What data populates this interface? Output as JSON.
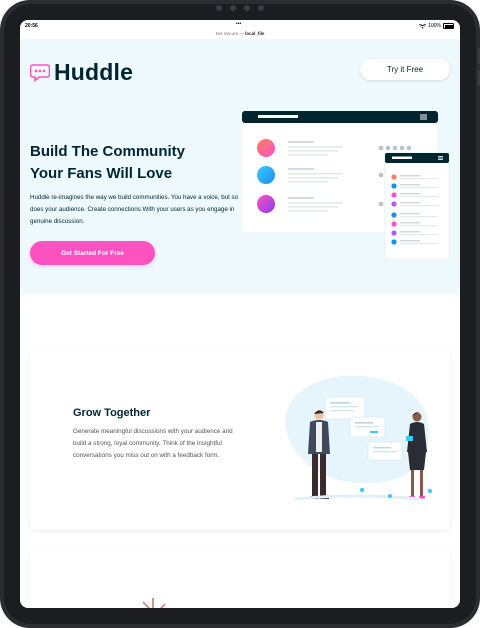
{
  "status_bar": {
    "time": "20:56",
    "dots": "•••",
    "battery": "100%"
  },
  "url_bar": {
    "prefix": "Not Secure — ",
    "host": "local_file"
  },
  "header": {
    "brand": "Huddle",
    "try_button": "Try it Free"
  },
  "hero": {
    "title_line1": "Build The Community",
    "title_line2": "Your Fans Will Love",
    "text": "Huddle re-imagines the way we build communities. You have a voice, but so does your audience. Create connections With your users as you engage in genuine discussion.",
    "cta": "Get Started For Free"
  },
  "feature": {
    "title": "Grow Together",
    "text": "Generate meaningful discussions with your audience and build a strong, loyal community. Think of the insightful conversations you miss out on with a feedback form."
  },
  "colors": {
    "brand_dark": "#00252e",
    "accent_pink": "#ff52c1",
    "hero_bg": "#eef9fe"
  },
  "icons": [
    "chat-bubble-logo-icon",
    "wifi-icon",
    "battery-icon",
    "hamburger-icon"
  ]
}
